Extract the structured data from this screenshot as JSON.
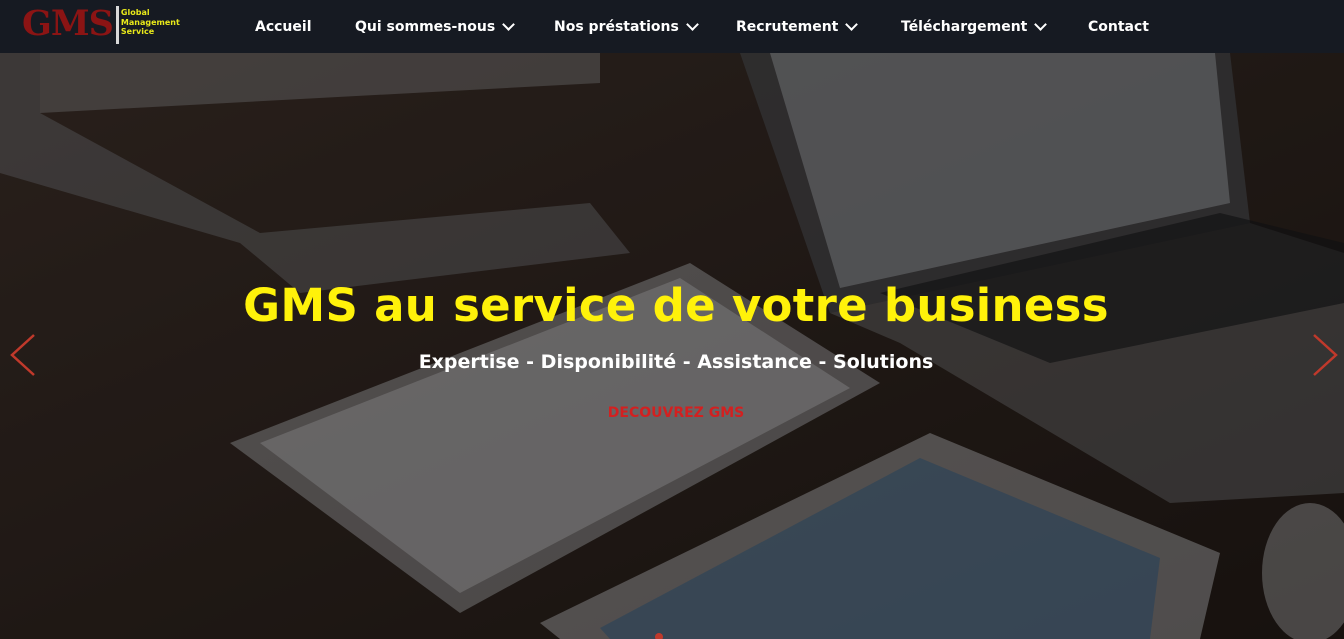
{
  "logo": {
    "mark": "GMS",
    "line1": "Global",
    "line2": "Management",
    "line3": "Service"
  },
  "nav": {
    "items": [
      {
        "label": "Accueil",
        "dropdown": false
      },
      {
        "label": "Qui sommes-nous",
        "dropdown": true
      },
      {
        "label": "Nos préstations",
        "dropdown": true
      },
      {
        "label": "Recrutement",
        "dropdown": true
      },
      {
        "label": "Téléchargement",
        "dropdown": true
      },
      {
        "label": "Contact",
        "dropdown": false
      }
    ]
  },
  "hero": {
    "title": "GMS au service de votre business",
    "subtitle": "Expertise - Disponibilité - Assistance - Solutions",
    "cta": "DECOUVREZ GMS"
  },
  "colors": {
    "header_bg": "#161a22",
    "title": "#fff20a",
    "cta": "#d32020",
    "arrows": "#c0392b",
    "logo_mark": "#8b1414",
    "logo_sub": "#e8e81a"
  },
  "icons": {
    "prev": "chevron-left-icon",
    "next": "chevron-right-icon",
    "dropdown": "chevron-down-icon"
  }
}
